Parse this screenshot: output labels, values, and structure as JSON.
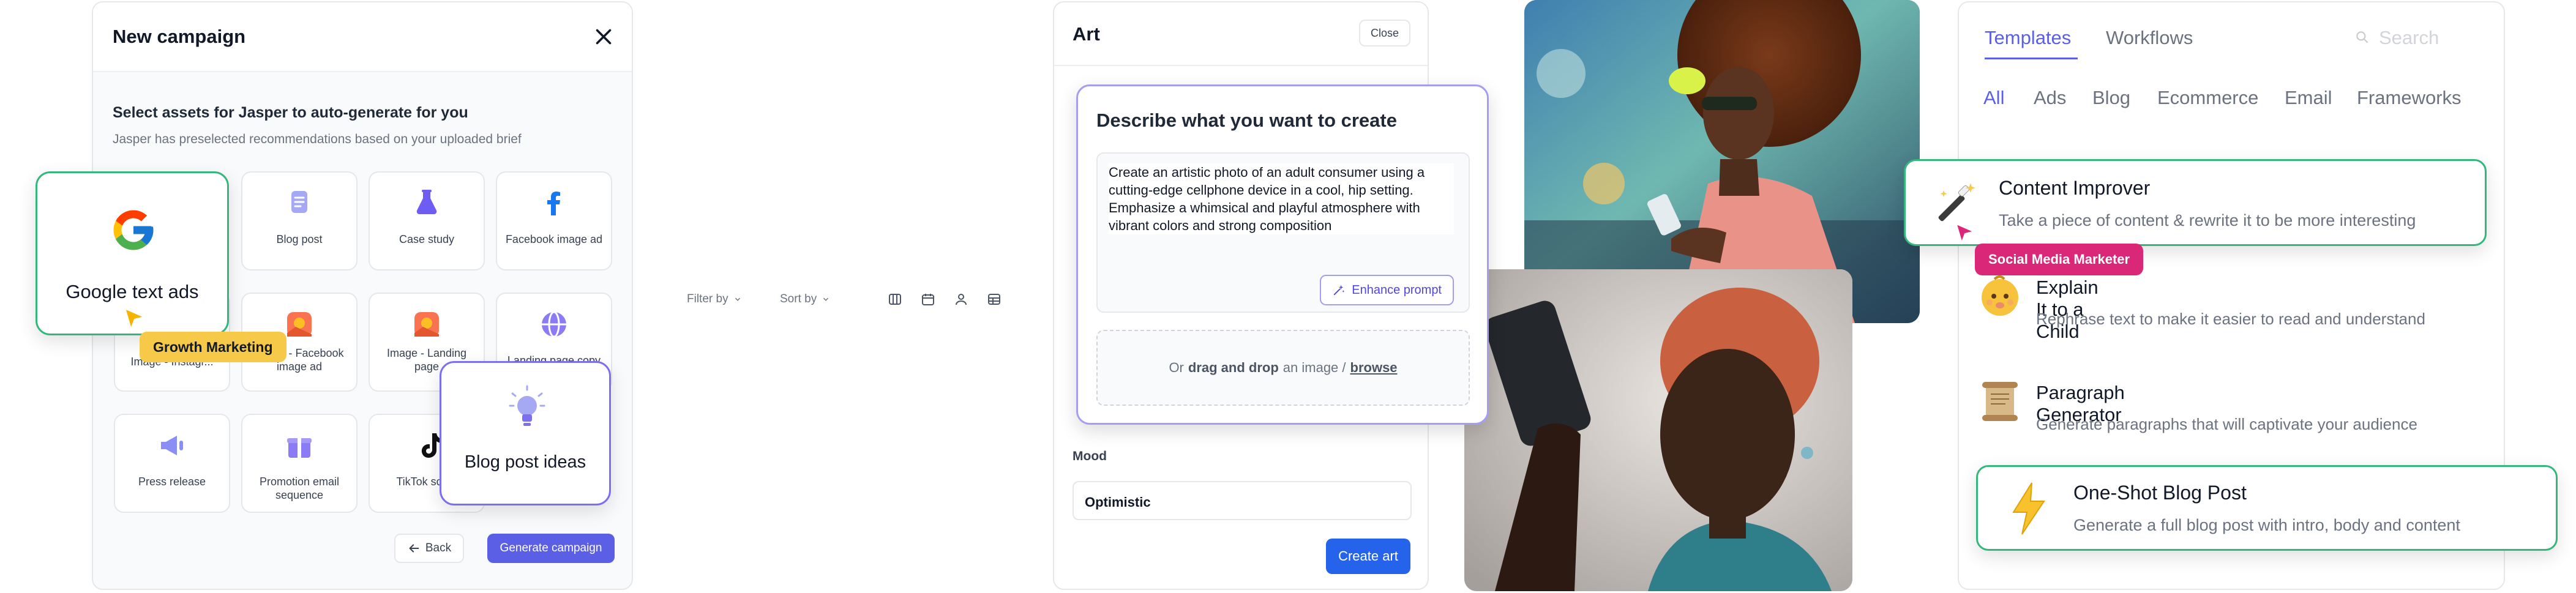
{
  "campaign": {
    "title": "New campaign",
    "subtitle": "Select assets for Jasper to auto-generate for you",
    "hint": "Jasper has preselected recommendations based on your uploaded brief",
    "assets": [
      {
        "label": "Blog post",
        "icon": "document-icon"
      },
      {
        "label": "Case study",
        "icon": "flask-icon"
      },
      {
        "label": "Facebook image ad",
        "icon": "facebook-icon"
      },
      {
        "label": "Image - Instagr...",
        "icon": "image-icon"
      },
      {
        "label": "Image - Facebook image ad",
        "icon": "image-icon"
      },
      {
        "label": "Image - Landing page",
        "icon": "image-icon"
      },
      {
        "label": "Landing page copy",
        "icon": "globe-icon"
      },
      {
        "label": "Press release",
        "icon": "megaphone-icon"
      },
      {
        "label": "Promotion email sequence",
        "icon": "gift-icon"
      },
      {
        "label": "TikTok script",
        "icon": "tiktok-icon"
      }
    ],
    "back_label": "Back",
    "generate_label": "Generate campaign",
    "google_card_label": "Google text ads",
    "growth_tag": "Growth Marketing",
    "blog_ideas_label": "Blog post ideas",
    "accent_color": "#5b5fe6"
  },
  "toolbar": {
    "filter_label": "Filter by",
    "sort_label": "Sort by"
  },
  "art": {
    "title": "Art",
    "close_label": "Close",
    "describe_title": "Describe what you want to create",
    "prompt": "Create an artistic photo of an adult consumer using a cutting-edge cellphone device in a cool, hip setting. Emphasize a whimsical and playful atmosphere with vibrant colors and strong composition",
    "enhance_label": "Enhance prompt",
    "drop_or": "Or",
    "drop_dd": "drag and drop",
    "drop_mid": "an image /",
    "drop_browse": "browse",
    "mood_label": "Mood",
    "mood_value": "Optimistic",
    "create_label": "Create art"
  },
  "templates": {
    "tab_templates": "Templates",
    "tab_workflows": "Workflows",
    "search_placeholder": "Search",
    "categories": [
      "All",
      "Ads",
      "Blog",
      "Ecommerce",
      "Email",
      "Frameworks"
    ],
    "items": [
      {
        "title": "Content Improver",
        "desc": "Take a piece of content & rewrite it to be more interesting",
        "icon": "magic-wand-icon"
      },
      {
        "title": "Explain It to a Child",
        "desc": "Rephrase text to make it easier to read and understand",
        "icon": "baby-face-icon"
      },
      {
        "title": "Paragraph Generator",
        "desc": "Generate paragraphs that will captivate your audience",
        "icon": "scroll-icon"
      },
      {
        "title": "One-Shot Blog Post",
        "desc": "Generate a full blog post with intro, body and content",
        "icon": "lightning-icon"
      }
    ],
    "social_tag": "Social Media Marketer",
    "accent_color": "#5b5fe6",
    "highlight_color": "#34b77d"
  }
}
